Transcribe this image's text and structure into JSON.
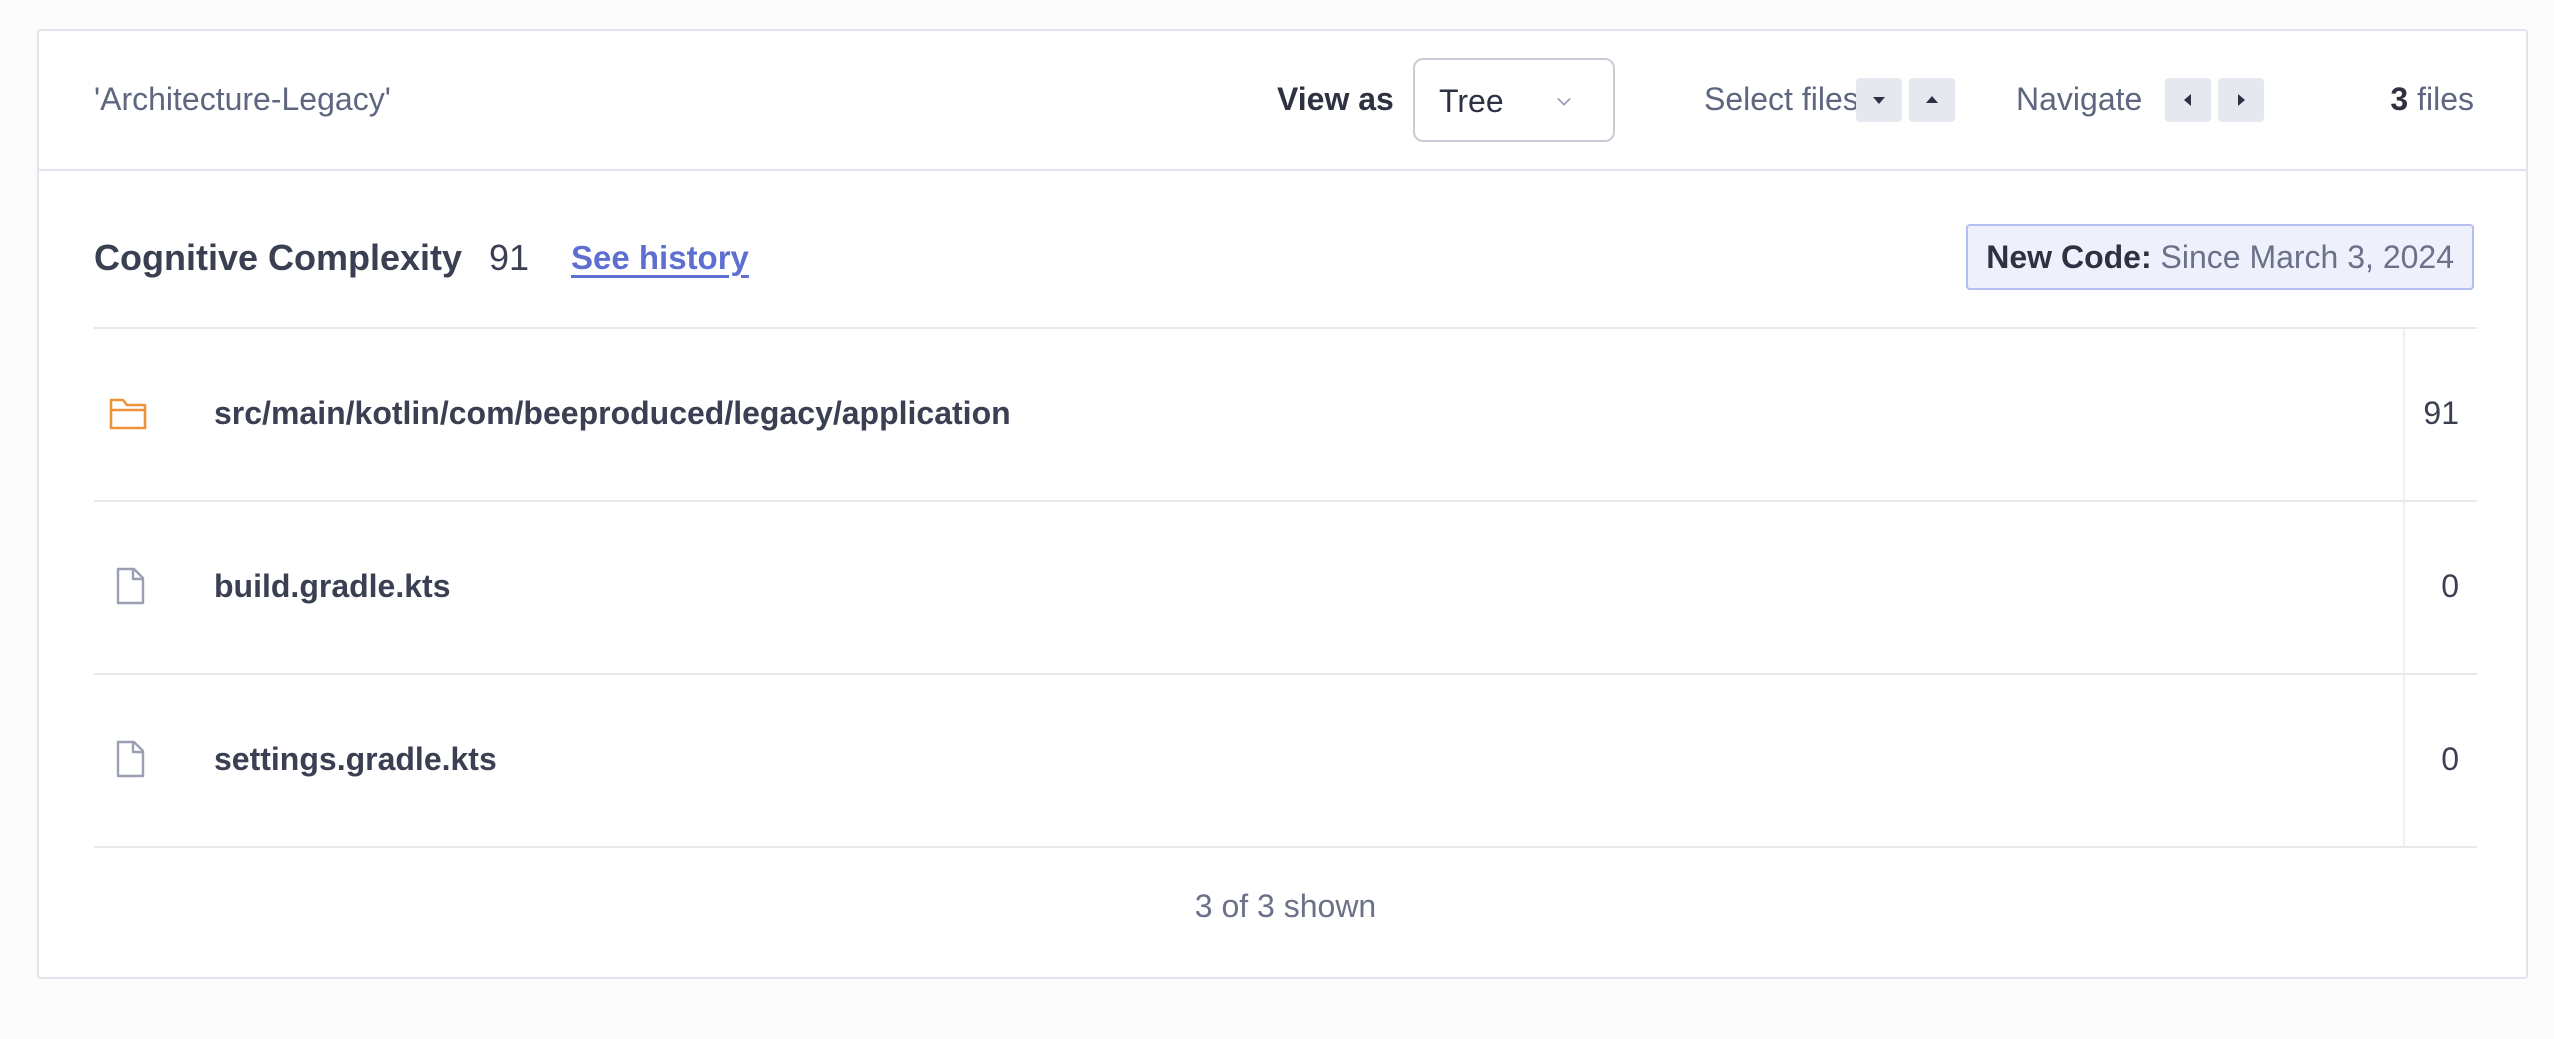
{
  "header": {
    "breadcrumb": "'Architecture-Legacy'",
    "view_as_label": "View as",
    "view_as_value": "Tree",
    "select_files_label": "Select files",
    "navigate_label": "Navigate",
    "files_count": "3",
    "files_suffix": "files"
  },
  "metric": {
    "title": "Cognitive Complexity",
    "value": "91",
    "history_link": "See history",
    "new_code_label": "New Code:",
    "new_code_since": "Since March 3, 2024"
  },
  "table": {
    "rows": [
      {
        "icon": "folder-icon",
        "name": "src/main/kotlin/com/beeproduced/legacy/application",
        "value": "91"
      },
      {
        "icon": "file-icon",
        "name": "build.gradle.kts",
        "value": "0"
      },
      {
        "icon": "file-icon",
        "name": "settings.gradle.kts",
        "value": "0"
      }
    ],
    "footer": "3 of 3 shown"
  },
  "colors": {
    "accent_link": "#5f6fd1",
    "folder_icon": "#f0923a",
    "new_code_bg": "#eef0fb",
    "new_code_border": "#b4bef2"
  }
}
